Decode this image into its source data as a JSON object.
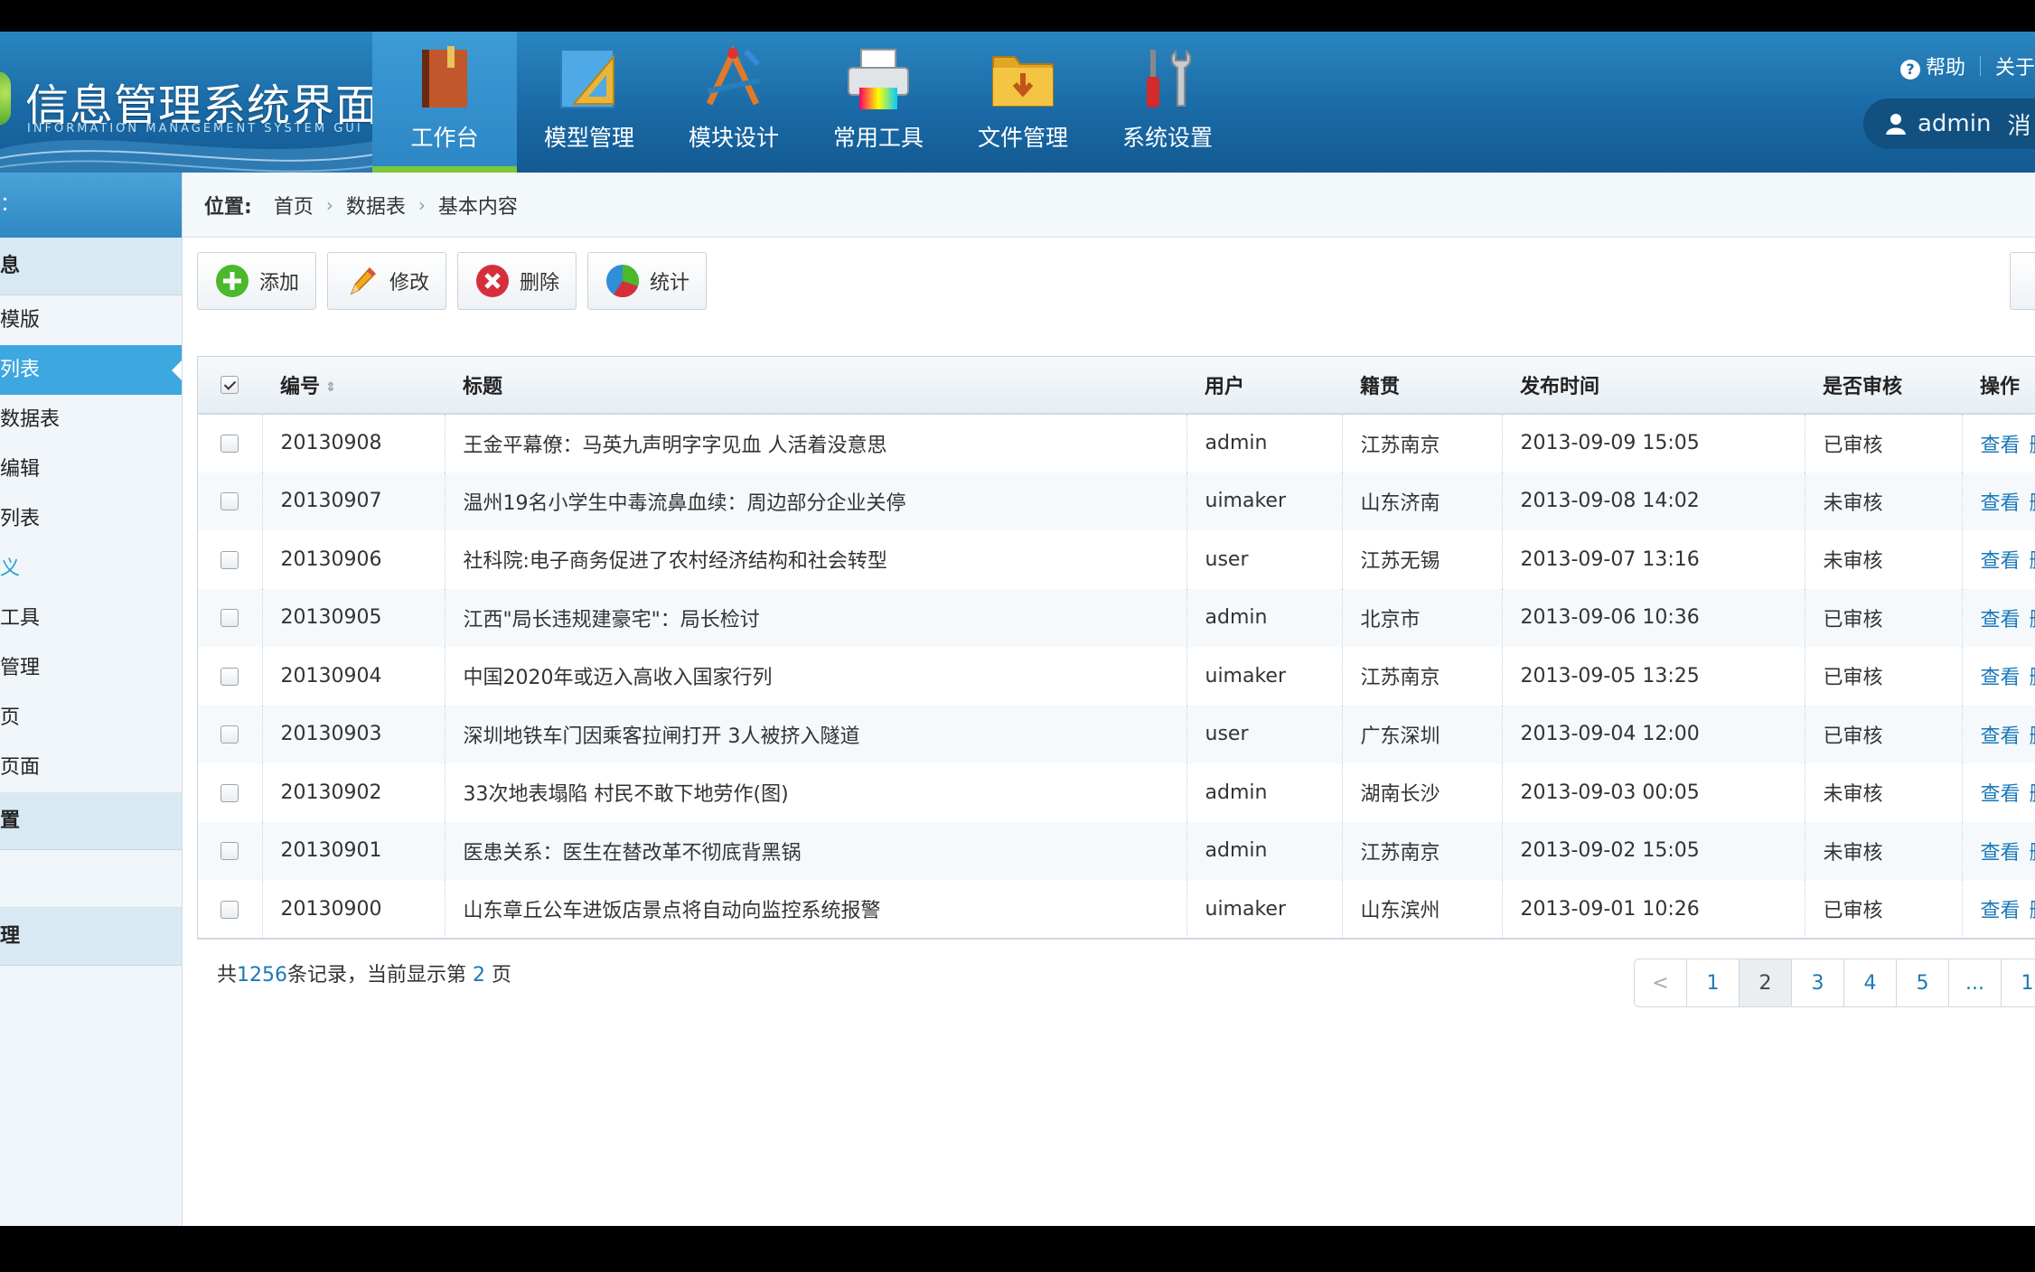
{
  "header": {
    "logo_title": "信息管理系统界面",
    "logo_subtitle": "INFORMATION MANAGEMENT SYSTEM GUI",
    "help_label": "帮助",
    "about_label": "关于",
    "user_name": "admin",
    "user_msg": "消",
    "nav": [
      {
        "label": "工作台",
        "icon": "book-icon"
      },
      {
        "label": "模型管理",
        "icon": "triangle-ruler-icon"
      },
      {
        "label": "模块设计",
        "icon": "drafting-tools-icon"
      },
      {
        "label": "常用工具",
        "icon": "printer-icon"
      },
      {
        "label": "文件管理",
        "icon": "folder-icon"
      },
      {
        "label": "系统设置",
        "icon": "wrench-icon"
      }
    ]
  },
  "sidebar": {
    "top": "：",
    "items": [
      {
        "type": "group",
        "label": "息"
      },
      {
        "type": "item",
        "label": "模版"
      },
      {
        "type": "item",
        "label": "列表",
        "active": true
      },
      {
        "type": "item",
        "label": "数据表"
      },
      {
        "type": "item",
        "label": "编辑"
      },
      {
        "type": "item",
        "label": "列表"
      },
      {
        "type": "link",
        "label": "义"
      },
      {
        "type": "item",
        "label": "工具"
      },
      {
        "type": "item",
        "label": "管理"
      },
      {
        "type": "item",
        "label": "页"
      },
      {
        "type": "item",
        "label": "页面"
      },
      {
        "type": "group",
        "label": "置"
      },
      {
        "type": "blank",
        "label": ""
      },
      {
        "type": "group",
        "label": "理"
      }
    ]
  },
  "breadcrumb": {
    "pos_label": "位置:",
    "items": [
      "首页",
      "数据表",
      "基本内容"
    ]
  },
  "toolbar": {
    "add": "添加",
    "edit": "修改",
    "delete": "删除",
    "stats": "统计"
  },
  "table": {
    "columns": [
      "编号",
      "标题",
      "用户",
      "籍贯",
      "发布时间",
      "是否审核",
      "操作"
    ],
    "view_label": "查看",
    "delete_label": "删",
    "rows": [
      {
        "id": "20130908",
        "title": "王金平幕僚：马英九声明字字见血 人活着没意思",
        "user": "admin",
        "origin": "江苏南京",
        "time": "2013-09-09 15:05",
        "status": "已审核"
      },
      {
        "id": "20130907",
        "title": "温州19名小学生中毒流鼻血续：周边部分企业关停",
        "user": "uimaker",
        "origin": "山东济南",
        "time": "2013-09-08 14:02",
        "status": "未审核"
      },
      {
        "id": "20130906",
        "title": "社科院:电子商务促进了农村经济结构和社会转型",
        "user": "user",
        "origin": "江苏无锡",
        "time": "2013-09-07 13:16",
        "status": "未审核"
      },
      {
        "id": "20130905",
        "title": "江西\"局长违规建豪宅\"：局长检讨",
        "user": "admin",
        "origin": "北京市",
        "time": "2013-09-06 10:36",
        "status": "已审核"
      },
      {
        "id": "20130904",
        "title": "中国2020年或迈入高收入国家行列",
        "user": "uimaker",
        "origin": "江苏南京",
        "time": "2013-09-05 13:25",
        "status": "已审核"
      },
      {
        "id": "20130903",
        "title": "深圳地铁车门因乘客拉闸打开 3人被挤入隧道",
        "user": "user",
        "origin": "广东深圳",
        "time": "2013-09-04 12:00",
        "status": "已审核"
      },
      {
        "id": "20130902",
        "title": "33次地表塌陷 村民不敢下地劳作(图)",
        "user": "admin",
        "origin": "湖南长沙",
        "time": "2013-09-03 00:05",
        "status": "未审核"
      },
      {
        "id": "20130901",
        "title": "医患关系：医生在替改革不彻底背黑锅",
        "user": "admin",
        "origin": "江苏南京",
        "time": "2013-09-02 15:05",
        "status": "未审核"
      },
      {
        "id": "20130900",
        "title": "山东章丘公车进饭店景点将自动向监控系统报警",
        "user": "uimaker",
        "origin": "山东滨州",
        "time": "2013-09-01 10:26",
        "status": "已审核"
      }
    ]
  },
  "footer": {
    "prefix": "共",
    "total": "1256",
    "middle": "条记录，当前显示第",
    "current": "2",
    "suffix": "页"
  },
  "pager": {
    "prev": "<",
    "pages": [
      "1",
      "2",
      "3",
      "4",
      "5",
      "...",
      "1"
    ],
    "current": "2"
  },
  "colors": {
    "header_blue": "#1a6aa6",
    "active_sidebar": "#3da7e0",
    "link_blue": "#1b79b8",
    "active_underline": "#7bc83b"
  }
}
